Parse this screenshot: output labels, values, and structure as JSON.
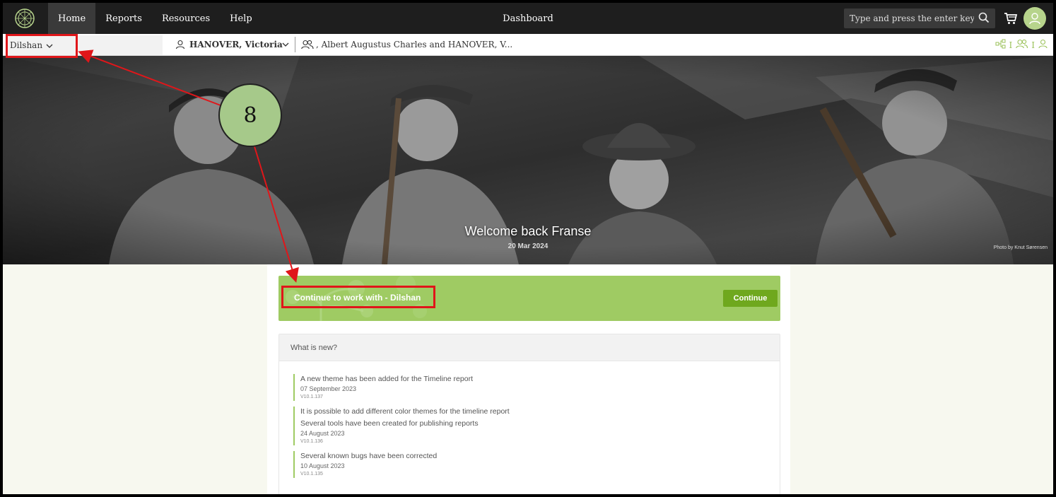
{
  "topbar": {
    "nav": [
      "Home",
      "Reports",
      "Resources",
      "Help"
    ],
    "title": "Dashboard",
    "search_placeholder": "Type and press the enter key",
    "icons": [
      "logo-icon",
      "search-icon",
      "cart-icon",
      "user-icon"
    ]
  },
  "subbar": {
    "workspace": "Dilshan",
    "person": "HANOVER, Victoria",
    "couple": ", Albert Augustus Charles and HANOVER, V...",
    "separator": "I"
  },
  "hero": {
    "welcome": "Welcome back Franse",
    "date": "20 Mar 2024",
    "credit": "Photo by Knut Sørensen"
  },
  "continue": {
    "text": "Continue to work with - Dilshan",
    "button": "Continue"
  },
  "whats_new": {
    "title": "What is new?",
    "items": [
      {
        "lines": [
          "A new theme has been added for the Timeline report"
        ],
        "date": "07 September 2023",
        "version": "V10.1.137"
      },
      {
        "lines": [
          "It is possible to add different color themes for the timeline report",
          "Several tools have been created for publishing reports"
        ],
        "date": "24 August 2023",
        "version": "V10.1.136"
      },
      {
        "lines": [
          "Several known bugs have been corrected"
        ],
        "date": "10 August 2023",
        "version": "V10.1.135"
      }
    ]
  },
  "annotation": {
    "step": "8"
  },
  "colors": {
    "accent": "#9fcb63",
    "button": "#6fa81e",
    "annotation": "#e0161a",
    "topbar": "#1e1e1e"
  }
}
